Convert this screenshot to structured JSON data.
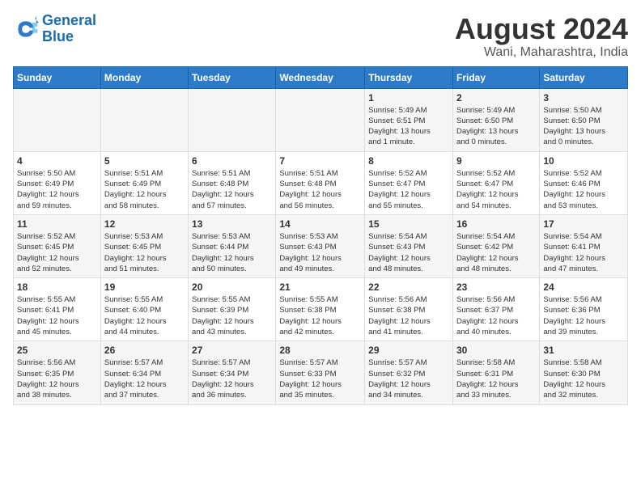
{
  "logo": {
    "line1": "General",
    "line2": "Blue"
  },
  "title": "August 2024",
  "location": "Wani, Maharashtra, India",
  "days_of_week": [
    "Sunday",
    "Monday",
    "Tuesday",
    "Wednesday",
    "Thursday",
    "Friday",
    "Saturday"
  ],
  "weeks": [
    [
      {
        "day": "",
        "info": ""
      },
      {
        "day": "",
        "info": ""
      },
      {
        "day": "",
        "info": ""
      },
      {
        "day": "",
        "info": ""
      },
      {
        "day": "1",
        "info": "Sunrise: 5:49 AM\nSunset: 6:51 PM\nDaylight: 13 hours\nand 1 minute."
      },
      {
        "day": "2",
        "info": "Sunrise: 5:49 AM\nSunset: 6:50 PM\nDaylight: 13 hours\nand 0 minutes."
      },
      {
        "day": "3",
        "info": "Sunrise: 5:50 AM\nSunset: 6:50 PM\nDaylight: 13 hours\nand 0 minutes."
      }
    ],
    [
      {
        "day": "4",
        "info": "Sunrise: 5:50 AM\nSunset: 6:49 PM\nDaylight: 12 hours\nand 59 minutes."
      },
      {
        "day": "5",
        "info": "Sunrise: 5:51 AM\nSunset: 6:49 PM\nDaylight: 12 hours\nand 58 minutes."
      },
      {
        "day": "6",
        "info": "Sunrise: 5:51 AM\nSunset: 6:48 PM\nDaylight: 12 hours\nand 57 minutes."
      },
      {
        "day": "7",
        "info": "Sunrise: 5:51 AM\nSunset: 6:48 PM\nDaylight: 12 hours\nand 56 minutes."
      },
      {
        "day": "8",
        "info": "Sunrise: 5:52 AM\nSunset: 6:47 PM\nDaylight: 12 hours\nand 55 minutes."
      },
      {
        "day": "9",
        "info": "Sunrise: 5:52 AM\nSunset: 6:47 PM\nDaylight: 12 hours\nand 54 minutes."
      },
      {
        "day": "10",
        "info": "Sunrise: 5:52 AM\nSunset: 6:46 PM\nDaylight: 12 hours\nand 53 minutes."
      }
    ],
    [
      {
        "day": "11",
        "info": "Sunrise: 5:52 AM\nSunset: 6:45 PM\nDaylight: 12 hours\nand 52 minutes."
      },
      {
        "day": "12",
        "info": "Sunrise: 5:53 AM\nSunset: 6:45 PM\nDaylight: 12 hours\nand 51 minutes."
      },
      {
        "day": "13",
        "info": "Sunrise: 5:53 AM\nSunset: 6:44 PM\nDaylight: 12 hours\nand 50 minutes."
      },
      {
        "day": "14",
        "info": "Sunrise: 5:53 AM\nSunset: 6:43 PM\nDaylight: 12 hours\nand 49 minutes."
      },
      {
        "day": "15",
        "info": "Sunrise: 5:54 AM\nSunset: 6:43 PM\nDaylight: 12 hours\nand 48 minutes."
      },
      {
        "day": "16",
        "info": "Sunrise: 5:54 AM\nSunset: 6:42 PM\nDaylight: 12 hours\nand 48 minutes."
      },
      {
        "day": "17",
        "info": "Sunrise: 5:54 AM\nSunset: 6:41 PM\nDaylight: 12 hours\nand 47 minutes."
      }
    ],
    [
      {
        "day": "18",
        "info": "Sunrise: 5:55 AM\nSunset: 6:41 PM\nDaylight: 12 hours\nand 45 minutes."
      },
      {
        "day": "19",
        "info": "Sunrise: 5:55 AM\nSunset: 6:40 PM\nDaylight: 12 hours\nand 44 minutes."
      },
      {
        "day": "20",
        "info": "Sunrise: 5:55 AM\nSunset: 6:39 PM\nDaylight: 12 hours\nand 43 minutes."
      },
      {
        "day": "21",
        "info": "Sunrise: 5:55 AM\nSunset: 6:38 PM\nDaylight: 12 hours\nand 42 minutes."
      },
      {
        "day": "22",
        "info": "Sunrise: 5:56 AM\nSunset: 6:38 PM\nDaylight: 12 hours\nand 41 minutes."
      },
      {
        "day": "23",
        "info": "Sunrise: 5:56 AM\nSunset: 6:37 PM\nDaylight: 12 hours\nand 40 minutes."
      },
      {
        "day": "24",
        "info": "Sunrise: 5:56 AM\nSunset: 6:36 PM\nDaylight: 12 hours\nand 39 minutes."
      }
    ],
    [
      {
        "day": "25",
        "info": "Sunrise: 5:56 AM\nSunset: 6:35 PM\nDaylight: 12 hours\nand 38 minutes."
      },
      {
        "day": "26",
        "info": "Sunrise: 5:57 AM\nSunset: 6:34 PM\nDaylight: 12 hours\nand 37 minutes."
      },
      {
        "day": "27",
        "info": "Sunrise: 5:57 AM\nSunset: 6:34 PM\nDaylight: 12 hours\nand 36 minutes."
      },
      {
        "day": "28",
        "info": "Sunrise: 5:57 AM\nSunset: 6:33 PM\nDaylight: 12 hours\nand 35 minutes."
      },
      {
        "day": "29",
        "info": "Sunrise: 5:57 AM\nSunset: 6:32 PM\nDaylight: 12 hours\nand 34 minutes."
      },
      {
        "day": "30",
        "info": "Sunrise: 5:58 AM\nSunset: 6:31 PM\nDaylight: 12 hours\nand 33 minutes."
      },
      {
        "day": "31",
        "info": "Sunrise: 5:58 AM\nSunset: 6:30 PM\nDaylight: 12 hours\nand 32 minutes."
      }
    ]
  ]
}
